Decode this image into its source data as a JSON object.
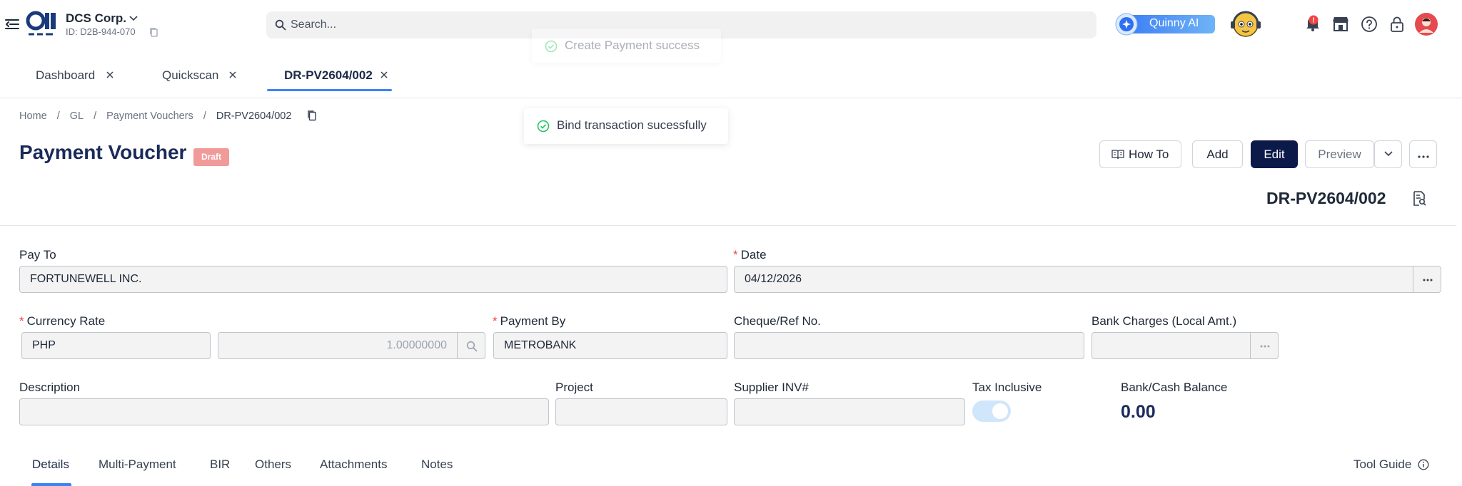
{
  "header": {
    "company_name": "DCS Corp.",
    "company_id": "ID: D2B-944-070",
    "search_placeholder": "Search...",
    "ai_label": "Quinny AI",
    "notification_badge": "!"
  },
  "toasts": {
    "faded": "Create Payment success",
    "main": "Bind transaction sucessfully"
  },
  "tabs": [
    {
      "label": "Dashboard"
    },
    {
      "label": "Quickscan"
    },
    {
      "label": "DR-PV2604/002"
    }
  ],
  "breadcrumb": [
    "Home",
    "GL",
    "Payment Vouchers",
    "DR-PV2604/002"
  ],
  "page": {
    "title": "Payment Voucher",
    "status": "Draft",
    "doc_number": "DR-PV2604/002"
  },
  "actions": {
    "how_to": "How To",
    "add": "Add",
    "edit": "Edit",
    "preview": "Preview"
  },
  "form": {
    "pay_to": {
      "label": "Pay To",
      "value": "FORTUNEWELL INC."
    },
    "date": {
      "label": "Date",
      "value": "04/12/2026"
    },
    "currency_rate": {
      "label": "Currency Rate",
      "currency": "PHP",
      "rate": "1.00000000"
    },
    "payment_by": {
      "label": "Payment By",
      "value": "METROBANK"
    },
    "cheque_ref": {
      "label": "Cheque/Ref No.",
      "value": ""
    },
    "bank_charges": {
      "label": "Bank Charges (Local Amt.)",
      "value": ""
    },
    "description": {
      "label": "Description",
      "value": ""
    },
    "project": {
      "label": "Project",
      "value": ""
    },
    "supplier_inv": {
      "label": "Supplier INV#",
      "value": ""
    },
    "tax_inclusive": {
      "label": "Tax Inclusive",
      "on": true
    },
    "bank_cash_balance": {
      "label": "Bank/Cash Balance",
      "value": "0.00"
    }
  },
  "subtabs": [
    "Details",
    "Multi-Payment",
    "BIR",
    "Others",
    "Attachments",
    "Notes"
  ],
  "tool_guide": "Tool Guide",
  "colors": {
    "primary": "#0c1a4a",
    "accent": "#3b82f6",
    "title": "#1a2a5a",
    "draft_badge": "#f19a9a",
    "required": "#ef4444",
    "success": "#22c55e"
  }
}
